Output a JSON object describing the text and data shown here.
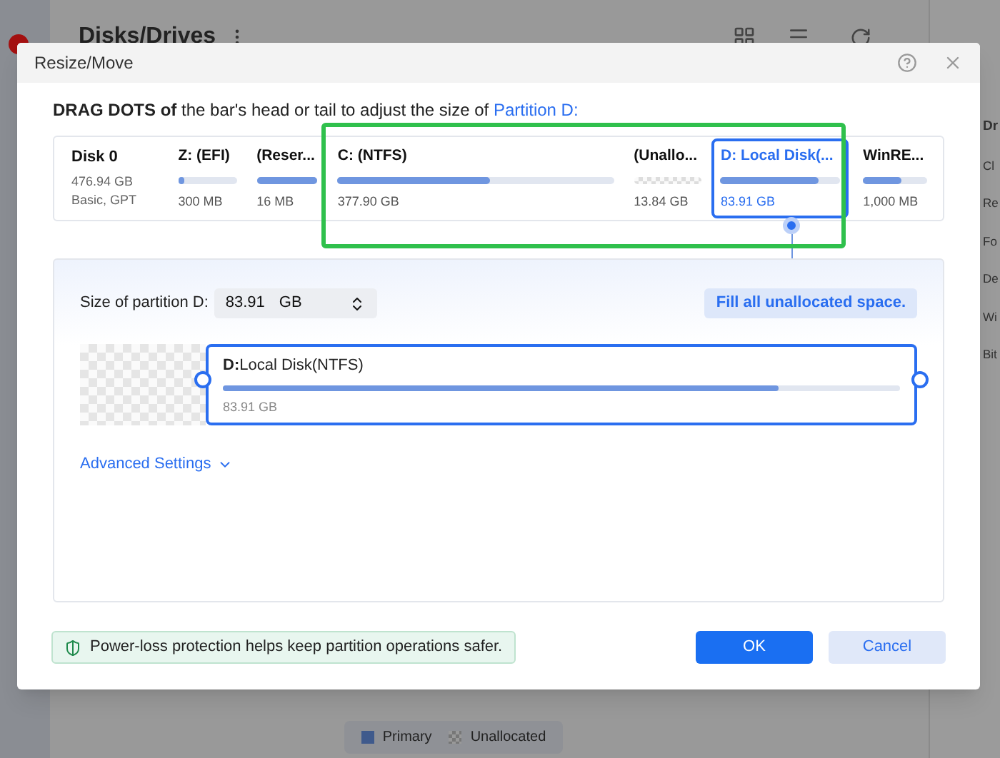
{
  "background": {
    "title": "Disks/Drives",
    "side_labels": [
      "Dr",
      "Cl",
      "Re",
      "Fo",
      "De",
      "Wi",
      "Bit"
    ],
    "legend": [
      {
        "label": "Primary",
        "kind": "primary"
      },
      {
        "label": "Unallocated",
        "kind": "unallocated"
      }
    ]
  },
  "dialog": {
    "title": "Resize/Move",
    "instruction": "**DRAG DOTS of** the bar's head or tail to adjust the size of ",
    "instruction_link": "Partition D:",
    "disk": {
      "name": "Disk 0",
      "size": "476.94 GB",
      "type": "Basic, GPT"
    },
    "partitions": [
      {
        "name": "Z: (EFI)",
        "size": "300 MB",
        "level": 0.1,
        "kind": "normal",
        "selected": false
      },
      {
        "name": "(Reser...",
        "size": "16 MB",
        "level": 1,
        "kind": "normal",
        "selected": false
      },
      {
        "name": "C: (NTFS)",
        "size": "377.90 GB",
        "level": 0.55,
        "kind": "normal",
        "selected": false
      },
      {
        "name": "(Unallo...",
        "size": "13.84 GB",
        "kind": "unallocated",
        "selected": false
      },
      {
        "name": "D: Local Disk(...",
        "size": "83.91 GB",
        "level": 0.82,
        "kind": "normal",
        "selected": true
      },
      {
        "name": "WinRE...",
        "size": "1,000 MB",
        "level": 0.6,
        "kind": "normal",
        "selected": false
      }
    ],
    "size_label": "Size of partition D:",
    "size_value": "83.91",
    "size_unit": "GB",
    "fill_button": "Fill all unallocated space.",
    "bar": {
      "letter": "D:",
      "label": "Local Disk(NTFS)",
      "size": "83.91 GB",
      "level": 0.82
    },
    "advanced": "Advanced Settings",
    "notice": "Power-loss protection helps keep partition operations safer.",
    "ok": "OK",
    "cancel": "Cancel"
  }
}
